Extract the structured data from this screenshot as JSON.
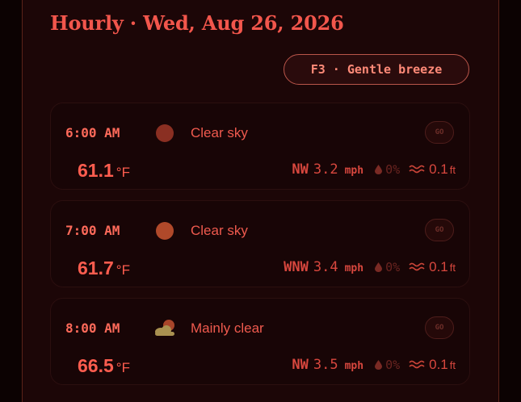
{
  "header": {
    "title": "Hourly · Wed, Aug 26, 2026",
    "wind_badge": "F3 · Gentle breeze"
  },
  "colors": {
    "accent": "#f2564c",
    "background": "#1c0607",
    "card": "#180506"
  },
  "hours": [
    {
      "time": "6:00 AM",
      "icon": "sun-dim-icon",
      "condition": "Clear sky",
      "go": "GO",
      "temp": "61.1",
      "temp_unit": "°F",
      "wind_dir": "NW",
      "wind_speed": "3.2",
      "wind_unit": "mph",
      "precip": "0%",
      "wave_height": "0.1",
      "wave_unit": "ft"
    },
    {
      "time": "7:00 AM",
      "icon": "sun-icon",
      "condition": "Clear sky",
      "go": "GO",
      "temp": "61.7",
      "temp_unit": "°F",
      "wind_dir": "WNW",
      "wind_speed": "3.4",
      "wind_unit": "mph",
      "precip": "0%",
      "wave_height": "0.1",
      "wave_unit": "ft"
    },
    {
      "time": "8:00 AM",
      "icon": "sun-behind-cloud-icon",
      "condition": "Mainly clear",
      "go": "GO",
      "temp": "66.5",
      "temp_unit": "°F",
      "wind_dir": "NW",
      "wind_speed": "3.5",
      "wind_unit": "mph",
      "precip": "0%",
      "wave_height": "0.1",
      "wave_unit": "ft"
    }
  ]
}
